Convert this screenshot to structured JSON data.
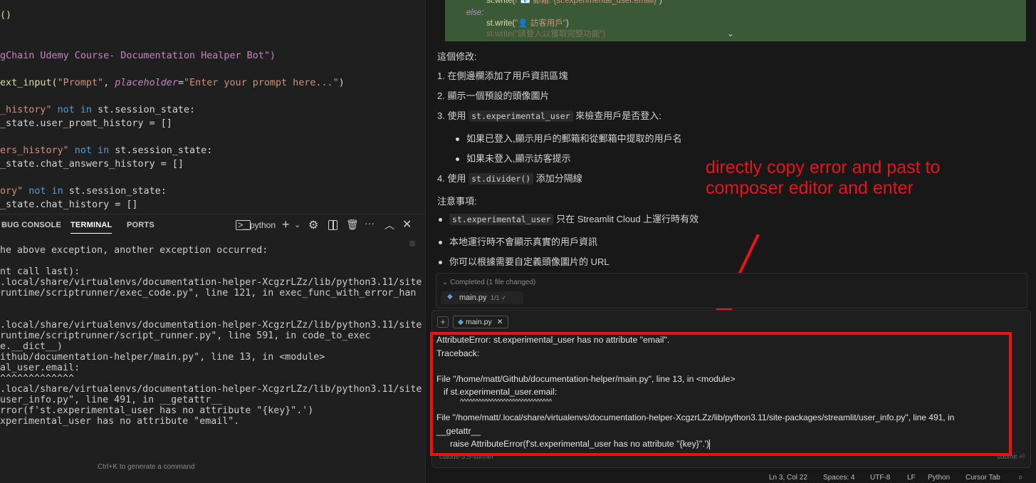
{
  "editor": {
    "lines": [
      [
        {
          "t": "()",
          "c": "yellow"
        }
      ],
      [],
      [],
      [
        {
          "t": "gChain Udemy Course- Documentation Healper Bot\")",
          "c": "purple"
        }
      ],
      [],
      [
        {
          "t": "ext_input(",
          "c": "yellow"
        },
        {
          "t": "\"Prompt\"",
          "c": "str"
        },
        {
          "t": ", ",
          "c": "plain"
        },
        {
          "t": "placeholder",
          "c": "param"
        },
        {
          "t": "=",
          "c": "plain"
        },
        {
          "t": "\"Enter your prompt here...\"",
          "c": "str"
        },
        {
          "t": ")",
          "c": "plain"
        }
      ],
      [],
      [
        {
          "t": "_history\"",
          "c": "str"
        },
        {
          "t": " not in ",
          "c": "kw"
        },
        {
          "t": "st.session_state:",
          "c": "plain"
        }
      ],
      [
        {
          "t": "_state.user_promt_history = []",
          "c": "plain"
        }
      ],
      [],
      [
        {
          "t": "ers_history\"",
          "c": "str"
        },
        {
          "t": " not in ",
          "c": "kw"
        },
        {
          "t": "st.session_state:",
          "c": "plain"
        }
      ],
      [
        {
          "t": "_state.chat_answers_history = []",
          "c": "plain"
        }
      ],
      [],
      [
        {
          "t": "ory\"",
          "c": "str"
        },
        {
          "t": " not in ",
          "c": "kw"
        },
        {
          "t": "st.session_state:",
          "c": "plain"
        }
      ],
      [
        {
          "t": "_state.chat_history = []",
          "c": "plain"
        }
      ]
    ]
  },
  "panel": {
    "tabs": [
      "BUG CONSOLE",
      "TERMINAL",
      "PORTS"
    ],
    "shell_label": "python",
    "icons": [
      "terminal-icon",
      "plus-icon",
      "chevron-down-icon",
      "gear-icon",
      "split-icon",
      "trash-icon",
      "more-icon",
      "chevron-up-icon",
      "close-icon"
    ]
  },
  "terminal": {
    "lines": [
      "he above exception, another exception occurred:",
      "",
      "nt call last):",
      ".local/share/virtualenvs/documentation-helper-XcgzrLZz/lib/python3.11/site",
      "runtime/scriptrunner/exec_code.py\", line 121, in exec_func_with_error_han",
      "",
      "",
      ".local/share/virtualenvs/documentation-helper-XcgzrLZz/lib/python3.11/site",
      "runtime/scriptrunner/script_runner.py\", line 591, in code_to_exec",
      "e.__dict__)",
      "ithub/documentation-helper/main.py\", line 13, in <module>",
      "al_user.email:",
      "^^^^^^^^^^^^^",
      ".local/share/virtualenvs/documentation-helper-XcgzrLZz/lib/python3.11/site",
      "user_info.py\", line 491, in __getattr__",
      "rror(f'st.experimental_user has no attribute \"{key}\".')",
      "xperimental_user has no attribute \"email\"."
    ],
    "hint": "Ctrl+K to generate a command"
  },
  "chat": {
    "code_lines": [
      {
        "parts": [
          {
            "t": "st.write(f\"📧 郵箱: {st.experimental_user.email}\")",
            "c": "mix"
          }
        ],
        "indent": 58
      },
      {
        "parts": [
          {
            "t": "else:",
            "c": "kw"
          }
        ],
        "indent": 30
      },
      {
        "parts": [
          {
            "t": "st.write(",
            "c": "fn"
          },
          {
            "t": "\"👤 訪客用戶\"",
            "c": "str"
          },
          {
            "t": ")",
            "c": "plain"
          }
        ],
        "indent": 58
      },
      {
        "parts": [
          {
            "t": "st.write(\"請登入以獲取完整功能\")",
            "c": "fade"
          }
        ],
        "indent": 58
      }
    ],
    "summary_title": "這個修改:",
    "items": [
      {
        "num": "1.",
        "text": "在側邊欄添加了用戶資訊區塊"
      },
      {
        "num": "2.",
        "text": "顯示一個預設的頭像圖片"
      },
      {
        "num": "3.",
        "pre": "使用 ",
        "code": "st.experimental_user",
        "post": " 來檢查用戶是否登入:"
      },
      {
        "num": "4.",
        "pre": "使用 ",
        "code": "st.divider()",
        "post": " 添加分隔線"
      }
    ],
    "sub_items": [
      "如果已登入,顯示用戶的郵箱和從郵箱中提取的用戶名",
      "如果未登入,顯示訪客提示"
    ],
    "notes_title": "注意事項:",
    "notes": [
      {
        "code": "st.experimental_user",
        "text": " 只在 Streamlit Cloud 上運行時有效"
      },
      {
        "text": "本地運行時不會顯示真實的用戶資訊"
      },
      {
        "text": "你可以根據需要自定義頭像圖片的 URL"
      }
    ],
    "completed_label": "Completed (1 file changed)",
    "completed_file": "main.py",
    "completed_count": "1/1 ✓"
  },
  "annotation": {
    "line1": "directly copy error and past to",
    "line2": "composer editor and enter",
    "color": "#e8141c"
  },
  "composer": {
    "context_chip": "main.py",
    "error_lines": [
      "AttributeError: st.experimental_user has no attribute \"email\".",
      "Traceback:",
      "",
      "File \"/home/matt/Github/documentation-helper/main.py\", line 13, in <module>",
      "    if st.experimental_user.email:",
      "       ^^^^^^^^^^^^^^^^^^^^^^^^^^^^^^",
      "File \"/home/matt/.local/share/virtualenvs/documentation-helper-XcgzrLZz/lib/python3.11/site-packages/streamlit/user_info.py\", line 491, in",
      "__getattr__",
      "    raise AttributeError(f'st.experimental_user has no attribute \"{key}\".')"
    ],
    "model_label": "claude-3.5-sonnet",
    "submit_label": "submit"
  },
  "status_bar": {
    "items": [
      "Ln 3, Col 22",
      "Spaces: 4",
      "UTF-8",
      "LF",
      "Python",
      "Cursor Tab"
    ]
  }
}
